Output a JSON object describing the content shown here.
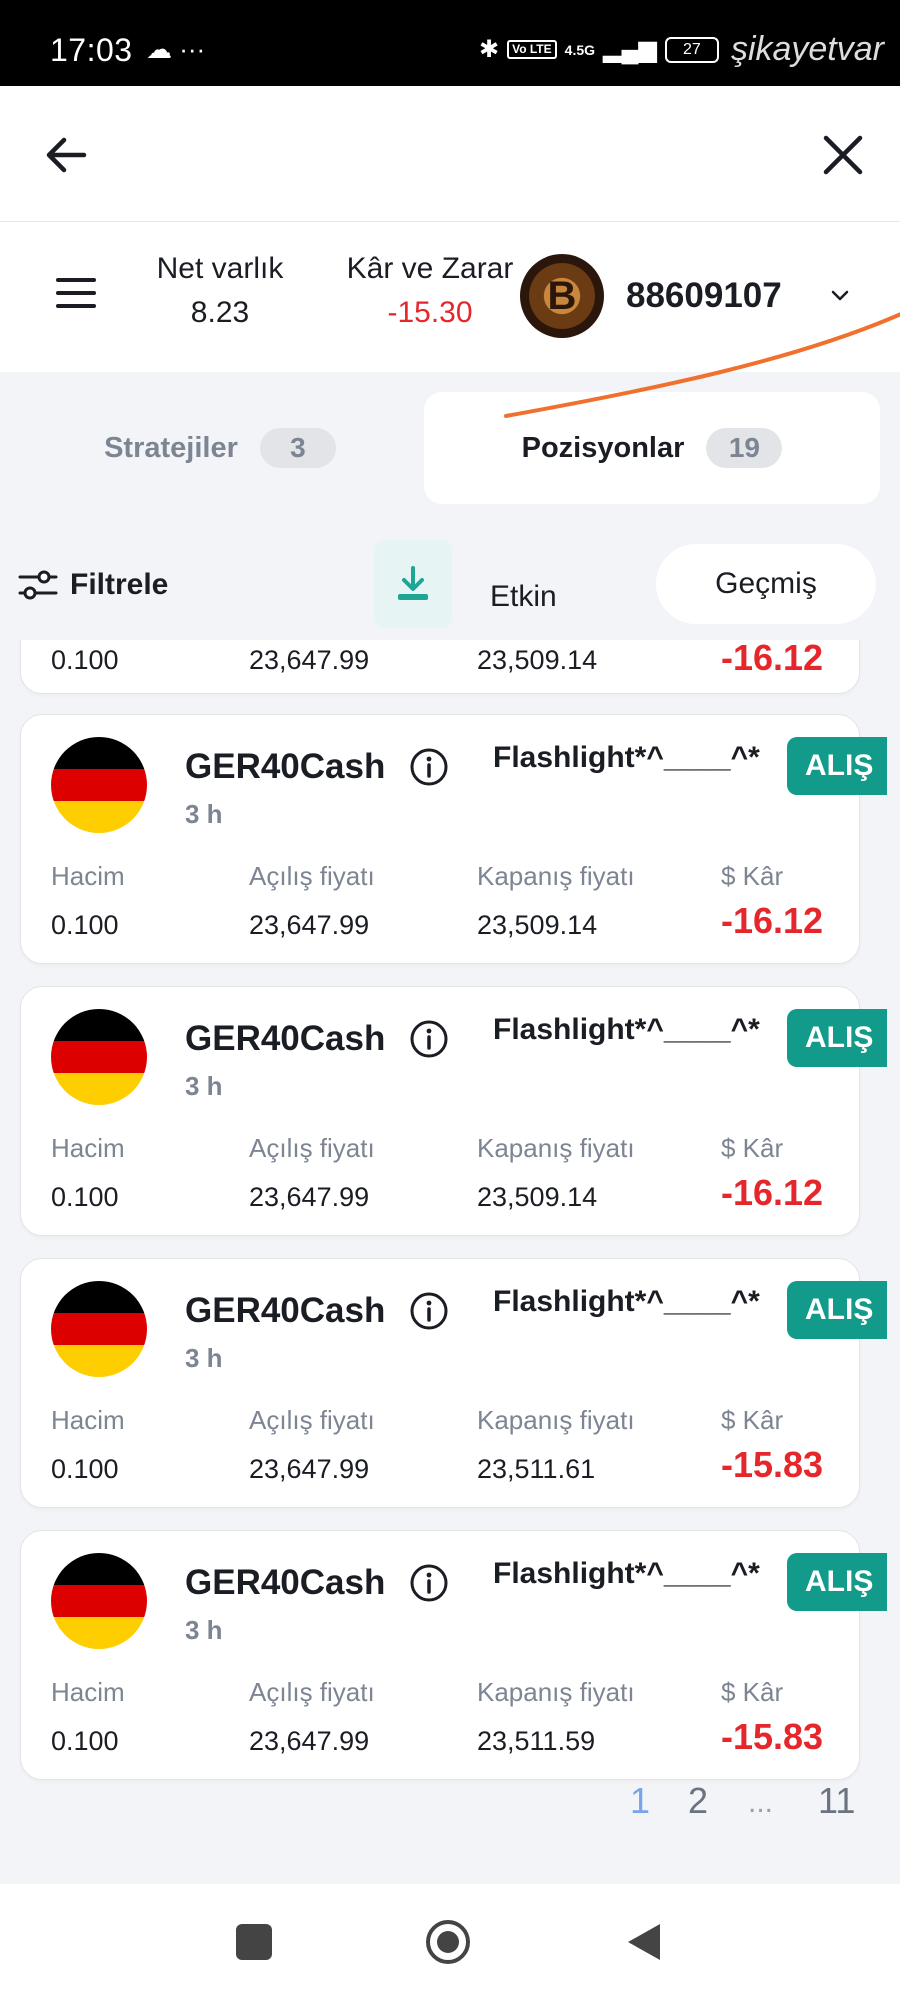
{
  "status_bar": {
    "time": "17:03",
    "left_icons": "☁ ···",
    "network": "4.5G",
    "volte": "Vo LTE",
    "battery": "27",
    "watermark": "şikayetvar"
  },
  "account": {
    "net_label": "Net varlık",
    "net_value": "8.23",
    "pnl_label": "Kâr ve Zarar",
    "pnl_value": "-15.30",
    "avatar_icon": "bitcoin-icon",
    "avatar_letter": "B",
    "account_id": "88609107"
  },
  "tabs": [
    {
      "label": "Stratejiler",
      "count": "3"
    },
    {
      "label": "Pozisyonlar",
      "count": "19"
    }
  ],
  "filter": {
    "label": "Filtrele",
    "active_label": "Etkin",
    "history_label": "Geçmiş"
  },
  "partial_card": {
    "volume": "0.100",
    "open_price": "23,647.99",
    "close_price": "23,509.14",
    "profit": "-16.12"
  },
  "labels": {
    "volume": "Hacim",
    "open_price": "Açılış fiyatı",
    "close_price": "Kapanış fiyatı",
    "profit": "$ Kâr"
  },
  "positions": [
    {
      "symbol": "GER40Cash",
      "strategy": "Flashlight*^____^*",
      "side": "ALIŞ",
      "duration": "3 h",
      "volume": "0.100",
      "open_price": "23,647.99",
      "close_price": "23,509.14",
      "profit": "-16.12"
    },
    {
      "symbol": "GER40Cash",
      "strategy": "Flashlight*^____^*",
      "side": "ALIŞ",
      "duration": "3 h",
      "volume": "0.100",
      "open_price": "23,647.99",
      "close_price": "23,509.14",
      "profit": "-16.12"
    },
    {
      "symbol": "GER40Cash",
      "strategy": "Flashlight*^____^*",
      "side": "ALIŞ",
      "duration": "3 h",
      "volume": "0.100",
      "open_price": "23,647.99",
      "close_price": "23,511.61",
      "profit": "-15.83"
    },
    {
      "symbol": "GER40Cash",
      "strategy": "Flashlight*^____^*",
      "side": "ALIŞ",
      "duration": "3 h",
      "volume": "0.100",
      "open_price": "23,647.99",
      "close_price": "23,511.59",
      "profit": "-15.83"
    }
  ],
  "pagination": {
    "current": "1",
    "next": "2",
    "ellipsis": "...",
    "last": "11"
  },
  "colors": {
    "loss": "#e5262b",
    "buy_badge": "#129a8a",
    "annotation_line": "#f0702e"
  }
}
